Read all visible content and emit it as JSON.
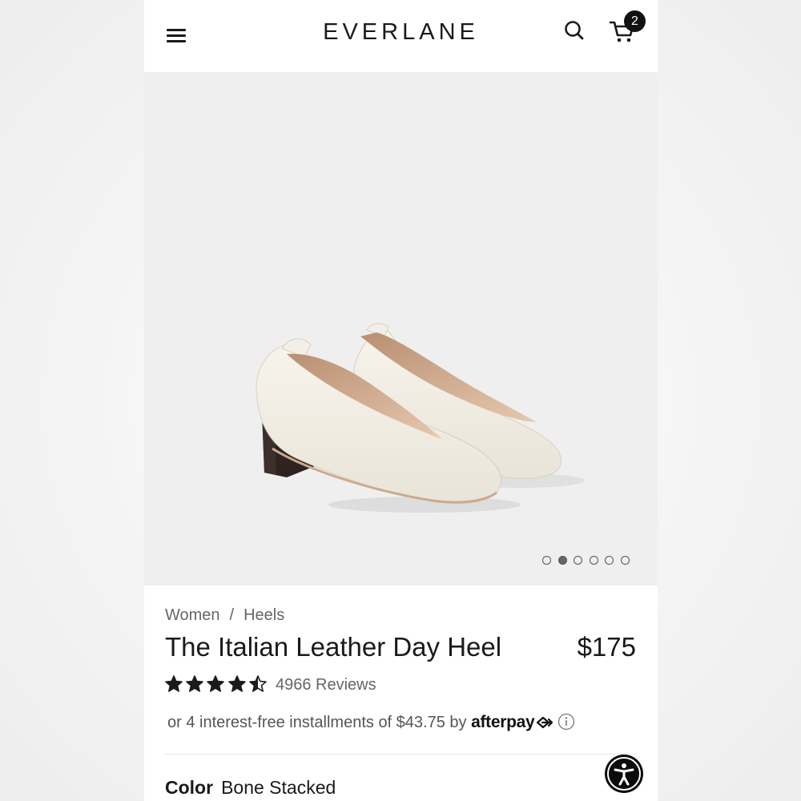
{
  "header": {
    "logo": "EVERLANE",
    "cart_count": "2"
  },
  "gallery": {
    "image_count": 6,
    "active_index": 1
  },
  "product": {
    "breadcrumb": [
      "Women",
      "Heels"
    ],
    "breadcrumb_separator": "/",
    "title": "The Italian Leather Day Heel",
    "price": "$175",
    "rating": 4.5,
    "rating_max": 5,
    "reviews": "4966 Reviews",
    "installments_text": "or 4 interest-free installments of $43.75 by",
    "afterpay_brand": "afterpay",
    "color_label": "Color",
    "color_value": "Bone Stacked"
  },
  "icons": {
    "menu": "menu-icon",
    "search": "search-icon",
    "cart": "cart-icon",
    "info": "info-icon",
    "accessibility": "accessibility-icon"
  },
  "colors": {
    "text": "#1a1a1a",
    "muted": "#666666",
    "image_bg": "#efefef",
    "badge": "#111111"
  }
}
